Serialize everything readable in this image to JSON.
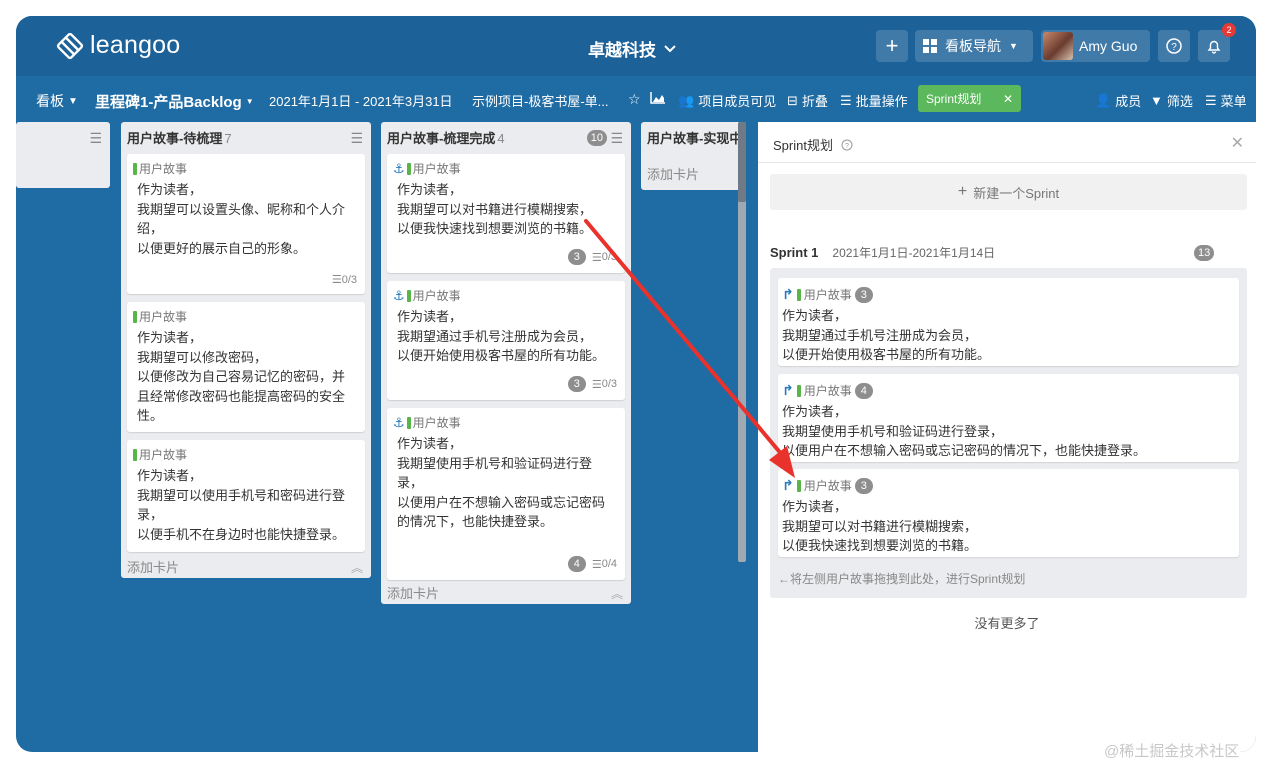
{
  "topbar": {
    "logo_text": "leangoo",
    "org_name": "卓越科技",
    "nav_label": "看板导航",
    "user_name": "Amy Guo",
    "notification_count": "2"
  },
  "subbar": {
    "board_menu": "看板",
    "board_title": "里程碑1-产品Backlog",
    "date_range": "2021年1月1日 - 2021年3月31日",
    "project": "示例项目-极客书屋-单...",
    "members_visible": "项目成员可见",
    "fold": "折叠",
    "batch": "批量操作",
    "sprint_plan": "Sprint规划",
    "right_members": "成员",
    "right_filter": "筛选",
    "right_menu": "菜单"
  },
  "lists": [
    {
      "title": "用户故事-待梳理",
      "count": "7",
      "add_card": "添加卡片",
      "cards": [
        {
          "tag": "用户故事",
          "lines": [
            "作为读者，",
            "我期望可以设置头像、昵称和个人介",
            "绍，",
            "以便更好的展示自己的形象。"
          ],
          "checklist": "0/3"
        },
        {
          "tag": "用户故事",
          "lines": [
            "作为读者，",
            "我期望可以修改密码，",
            "以便修改为自己容易记忆的密码，并",
            "且经常修改密码也能提高密码的安全",
            "性。"
          ]
        },
        {
          "tag": "用户故事",
          "lines": [
            "作为读者，",
            "我期望可以使用手机号和密码进行登",
            "录，",
            "以便手机不在身边时也能快捷登录。"
          ]
        }
      ]
    },
    {
      "title": "用户故事-梳理完成",
      "count": "4",
      "wip": "10",
      "add_card": "添加卡片",
      "cards": [
        {
          "tag": "用户故事",
          "lines": [
            "作为读者，",
            "我期望可以对书籍进行模糊搜索，",
            "以便我快速找到想要浏览的书籍。"
          ],
          "points": "3",
          "checklist": "0/3"
        },
        {
          "tag": "用户故事",
          "lines": [
            "作为读者，",
            "我期望通过手机号注册成为会员，",
            "以便开始使用极客书屋的所有功能。"
          ],
          "points": "3",
          "checklist": "0/3"
        },
        {
          "tag": "用户故事",
          "lines": [
            "作为读者，",
            "我期望使用手机号和验证码进行登",
            "录，",
            "以便用户在不想输入密码或忘记密码",
            "的情况下，也能快捷登录。"
          ],
          "points": "4",
          "checklist": "0/4"
        }
      ]
    },
    {
      "title": "用户故事-实现中",
      "add_card": "添加卡片"
    }
  ],
  "panel": {
    "title": "Sprint规划",
    "new_sprint": "新建一个Sprint",
    "sprint_name": "Sprint 1",
    "sprint_dates": "2021年1月1日-2021年1月14日",
    "sprint_points": "13",
    "cards": [
      {
        "tag": "用户故事",
        "points": "3",
        "lines": [
          "作为读者，",
          "我期望通过手机号注册成为会员，",
          "以便开始使用极客书屋的所有功能。"
        ]
      },
      {
        "tag": "用户故事",
        "points": "4",
        "lines": [
          "作为读者，",
          "我期望使用手机号和验证码进行登录，",
          "以便用户在不想输入密码或忘记密码的情况下，也能快捷登录。"
        ]
      },
      {
        "tag": "用户故事",
        "points": "3",
        "lines": [
          "作为读者，",
          "我期望可以对书籍进行模糊搜索，",
          "以便我快速找到想要浏览的书籍。"
        ]
      }
    ],
    "drop_hint": "←将左侧用户故事拖拽到此处，进行Sprint规划",
    "no_more": "没有更多了"
  },
  "watermark": "@稀土掘金技术社区",
  "colors": {
    "topbar": "#1c6198",
    "board_bg": "#1f6ba3",
    "story_tag": "#58b548",
    "sprint_button": "#5cb85c",
    "annotation_arrow": "#e8322b"
  }
}
